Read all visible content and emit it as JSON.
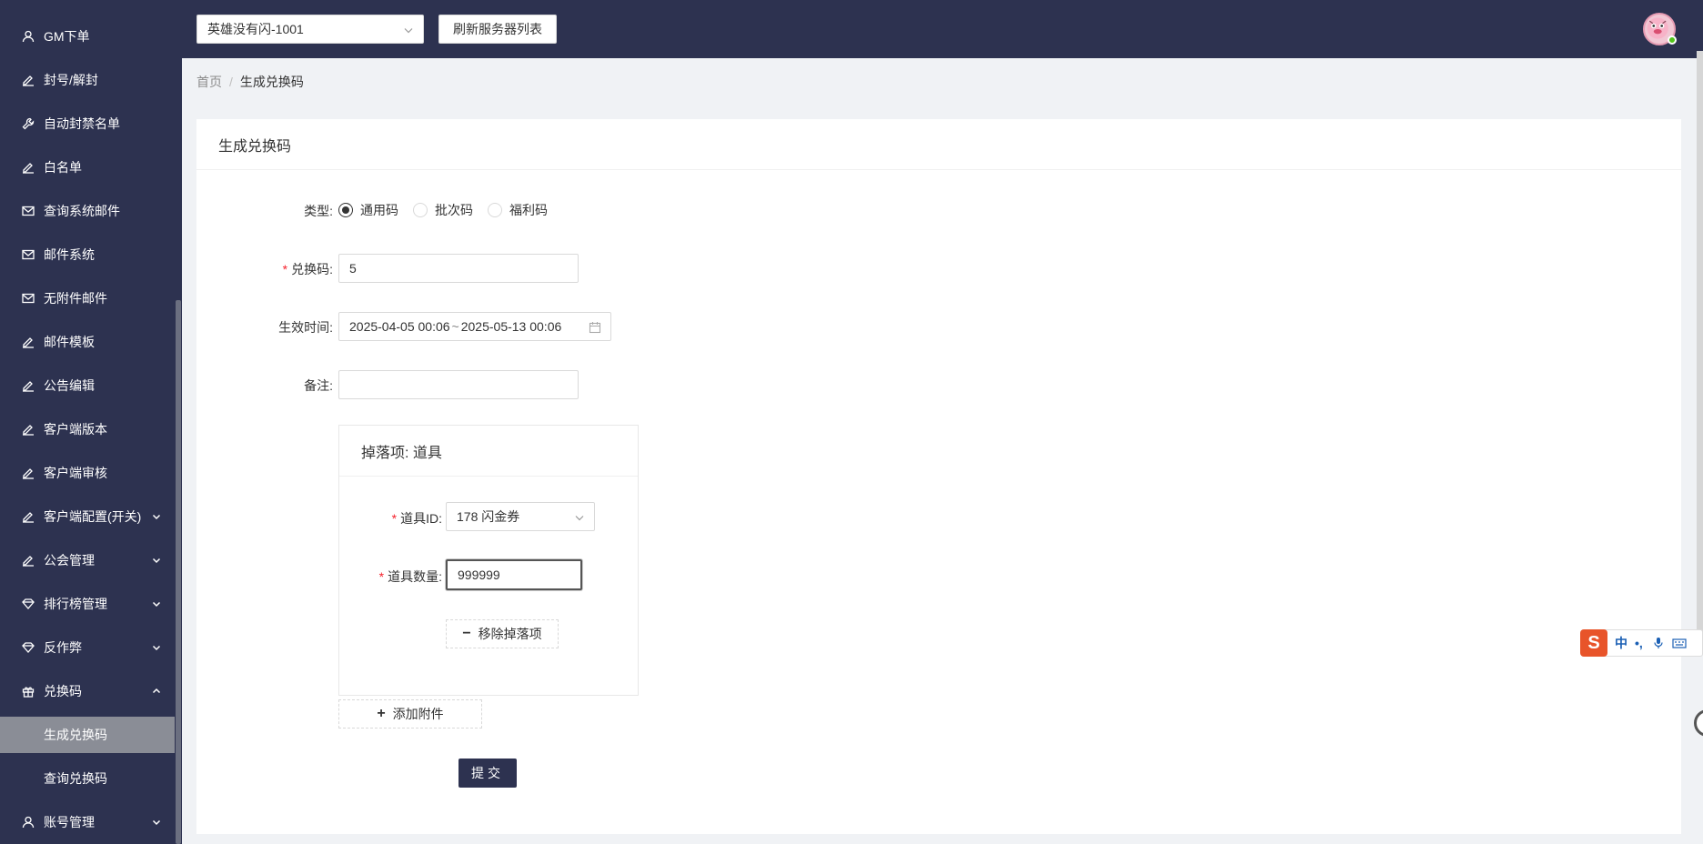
{
  "sidebar": {
    "items": [
      {
        "label": "GM下单",
        "icon": "user-icon"
      },
      {
        "label": "封号/解封",
        "icon": "edit-icon"
      },
      {
        "label": "自动封禁名单",
        "icon": "tool-icon"
      },
      {
        "label": "白名单",
        "icon": "edit-icon"
      },
      {
        "label": "查询系统邮件",
        "icon": "mail-icon"
      },
      {
        "label": "邮件系统",
        "icon": "mail-icon"
      },
      {
        "label": "无附件邮件",
        "icon": "mail-icon"
      },
      {
        "label": "邮件模板",
        "icon": "edit-icon"
      },
      {
        "label": "公告编辑",
        "icon": "edit-icon"
      },
      {
        "label": "客户端版本",
        "icon": "edit-icon"
      },
      {
        "label": "客户端审核",
        "icon": "edit-icon"
      },
      {
        "label": "客户端配置(开关)",
        "icon": "edit-icon"
      },
      {
        "label": "公会管理",
        "icon": "edit-icon"
      },
      {
        "label": "排行榜管理",
        "icon": "diamond-icon"
      },
      {
        "label": "反作弊",
        "icon": "diamond-icon"
      },
      {
        "label": "兑换码",
        "icon": "gift-icon"
      },
      {
        "label": "生成兑换码"
      },
      {
        "label": "查询兑换码"
      },
      {
        "label": "账号管理",
        "icon": "user-icon"
      }
    ]
  },
  "header": {
    "server_value": "英雄没有闪-1001",
    "refresh_label": "刷新服务器列表"
  },
  "breadcrumb": {
    "home": "首页",
    "separator": "/",
    "current": "生成兑换码"
  },
  "card": {
    "title": "生成兑换码"
  },
  "form": {
    "type_label": "类型:",
    "type_options": [
      "通用码",
      "批次码",
      "福利码"
    ],
    "type_selected": "通用码",
    "code_label": "兑换码:",
    "code_value": "5",
    "time_label": "生效时间:",
    "time_start": "2025-04-05 00:06",
    "time_sep": "~",
    "time_end": "2025-05-13 00:06",
    "note_label": "备注:",
    "note_value": ""
  },
  "drop": {
    "title": "掉落项: 道具",
    "item_id_label": "道具ID:",
    "item_id_value": "178 闪金券",
    "item_qty_label": "道具数量:",
    "item_qty_value": "999999",
    "remove_label": "移除掉落项"
  },
  "add_attachment_label": "添加附件",
  "submit_label": "提交",
  "ime": {
    "logo": "S",
    "mode": "中",
    "punct": "•,"
  }
}
